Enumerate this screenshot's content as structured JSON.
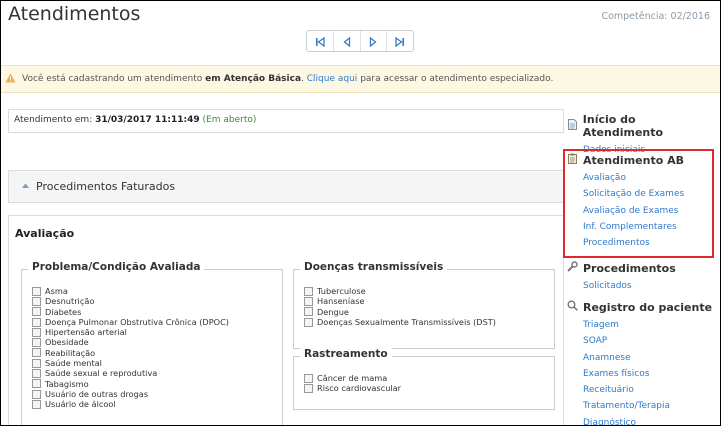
{
  "header": {
    "title": "Atendimentos",
    "competencia": "Competência: 02/2016"
  },
  "pager": [
    {
      "name": "first-page-icon",
      "glyph": "⏮"
    },
    {
      "name": "prev-page-icon",
      "glyph": "◀"
    },
    {
      "name": "next-page-icon",
      "glyph": "▶"
    },
    {
      "name": "last-page-icon",
      "glyph": "⏭"
    }
  ],
  "alert": {
    "prefix": "Você está cadastrando um atendimento ",
    "bold": "em Atenção Básica",
    "dot": ". ",
    "link": "Clique aqui",
    "suffix": " para acessar o atendimento especializado."
  },
  "atendimento": {
    "label": "Atendimento em: ",
    "datetime": "31/03/2017 11:11:49",
    "status": "(Em aberto)"
  },
  "procedimentos_faturados": "Procedimentos Faturados",
  "avaliacao": {
    "title": "Avaliação",
    "problema": {
      "legend": "Problema/Condição Avaliada",
      "items": [
        "Asma",
        "Desnutrição",
        "Diabetes",
        "Doença Pulmonar Obstrutiva Crônica (DPOC)",
        "Hipertensão arterial",
        "Obesidade",
        "Reabilitação",
        "Saúde mental",
        "Saúde sexual e reprodutiva",
        "Tabagismo",
        "Usuário de outras drogas",
        "Usuário de álcool"
      ]
    },
    "doencas": {
      "legend": "Doenças transmissíveis",
      "items": [
        "Tuberculose",
        "Hanseníase",
        "Dengue",
        "Doenças Sexualmente Transmissíveis (DST)"
      ]
    },
    "rastreamento": {
      "legend": "Rastreamento",
      "items": [
        "Câncer de mama",
        "Risco cardiovascular"
      ]
    }
  },
  "sidebar": {
    "inicio": {
      "title": "Início do Atendimento",
      "icon": "document-icon",
      "links": [
        "Dados iniciais"
      ]
    },
    "ab": {
      "title": "Atendimento AB",
      "icon": "clipboard-icon",
      "links": [
        "Avaliação",
        "Solicitação de Exames",
        "Avaliação de Exames",
        "Inf. Complementares",
        "Procedimentos"
      ]
    },
    "procedimentos": {
      "title": "Procedimentos",
      "icon": "wrench-icon",
      "links": [
        "Solicitados"
      ]
    },
    "registro": {
      "title": "Registro do paciente",
      "icon": "search-icon",
      "links": [
        "Triagem",
        "SOAP",
        "Anamnese",
        "Exames físicos",
        "Receituário",
        "Tratamento/Terapia",
        "Diagnóstico"
      ]
    }
  },
  "colors": {
    "link": "#2f7ac9",
    "highlight": "#e0282e",
    "alert_bg": "#fcf8e3"
  }
}
